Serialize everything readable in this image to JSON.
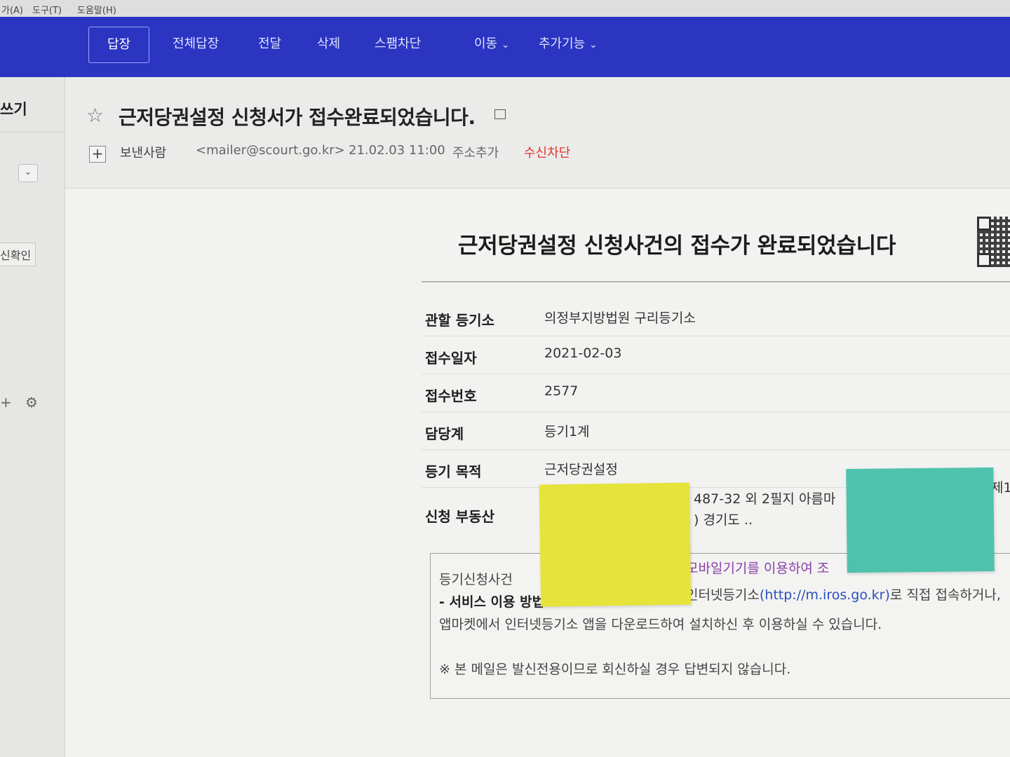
{
  "menu": {
    "item1": "가(A)",
    "item2": "도구(T)",
    "item3": "도움말(H)"
  },
  "toolbar": {
    "reply": "답장",
    "reply_all": "전체답장",
    "forward": "전달",
    "delete": "삭제",
    "block_spam": "스팸차단",
    "move": "이동",
    "more": "추가기능",
    "dropdown_glyph": "⌄"
  },
  "sidebar": {
    "compose": "쓰기",
    "read_check": "신확인"
  },
  "mail": {
    "subject": "근저당권설정 신청서가 접수완료되었습니다.",
    "sender_label": "보낸사람",
    "sender_email": "<mailer@scourt.go.kr>",
    "datetime": "21.02.03 11:00",
    "add_address": "주소추가",
    "block_receive": "수신차단"
  },
  "body": {
    "title": "근저당권설정 신청사건의 접수가 완료되었습니다",
    "rows": [
      {
        "label": "관할 등기소",
        "value": "의정부지방법원 구리등기소"
      },
      {
        "label": "접수일자",
        "value": "2021-02-03"
      },
      {
        "label": "접수번호",
        "value": "2577"
      },
      {
        "label": "담당계",
        "value": "등기1계"
      },
      {
        "label": "등기 목적",
        "value": "근저당권설정"
      }
    ],
    "property_label": "신청 부동산",
    "property_line1": "487-32 외 2필지 아름마",
    "property_line1_tail": "제1",
    "property_line2": ") 경기도 ..",
    "notice": {
      "line1_start": "등기신청사건",
      "line1_mobile": "모바일기기를 이용하여 조",
      "line2_service": "- 서비스 이용 방법",
      "line2_mid": "인터넷등기소",
      "line2_link": "(http://m.iros.go.kr)",
      "line2_tail": "로 직접 접속하거나,",
      "line3": "앱마켓에서 인터넷등기소 앱을 다운로드하여 설치하신 후 이용하실 수 있습니다.",
      "line4": "※ 본 메일은 발신전용이므로 회신하실 경우 답변되지 않습니다."
    }
  }
}
